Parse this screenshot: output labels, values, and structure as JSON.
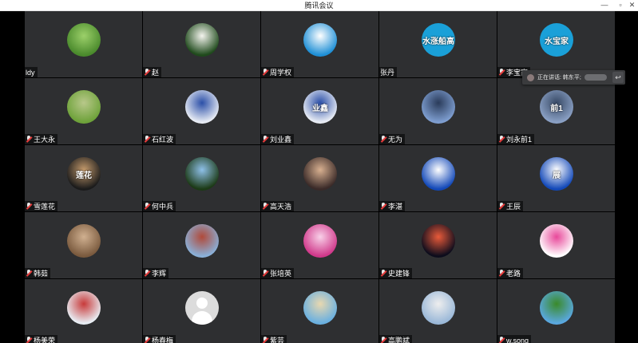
{
  "window": {
    "title": "腾讯会议",
    "min_glyph": "—",
    "max_glyph": "▫",
    "close_glyph": "✕"
  },
  "speaking": {
    "label": "正在讲话: 韩东平;",
    "return_glyph": "↩"
  },
  "participants": [
    {
      "name": "ldy",
      "muted": false,
      "avatar_icon": "green-grass-avatar",
      "avatar_text": "",
      "colors": [
        "#4a8a2c",
        "#9cd06a"
      ]
    },
    {
      "name": "赵",
      "muted": true,
      "avatar_icon": "white-flower-avatar",
      "avatar_text": "",
      "colors": [
        "#1f4a1c",
        "#f4f4ee"
      ]
    },
    {
      "name": "周学权",
      "muted": true,
      "avatar_icon": "doraemon-avatar",
      "avatar_text": "",
      "colors": [
        "#1e8fd6",
        "#ffffff"
      ]
    },
    {
      "name": "张丹",
      "muted": false,
      "avatar_icon": "blue-text-avatar",
      "avatar_text": "水涨船高",
      "colors": [
        "#1aa0d8",
        "#1aa0d8"
      ]
    },
    {
      "name": "李宝家",
      "muted": true,
      "avatar_icon": "blue-text-avatar",
      "avatar_text": "水宝家",
      "colors": [
        "#1aa0d8",
        "#1aa0d8"
      ]
    },
    {
      "name": "王大永",
      "muted": true,
      "avatar_icon": "bird-avatar",
      "avatar_text": "",
      "colors": [
        "#6ea23a",
        "#b8c88a"
      ]
    },
    {
      "name": "石红波",
      "muted": true,
      "avatar_icon": "porcelain-avatar",
      "avatar_text": "",
      "colors": [
        "#e8ecf4",
        "#2b4fa8"
      ]
    },
    {
      "name": "刘业鑫",
      "muted": true,
      "avatar_icon": "porcelain-text-avatar",
      "avatar_text": "业鑫",
      "colors": [
        "#e8ecf4",
        "#2b4fa8"
      ]
    },
    {
      "name": "无为",
      "muted": true,
      "avatar_icon": "statue-sky-avatar",
      "avatar_text": "",
      "colors": [
        "#7e9ed0",
        "#2a3b5a"
      ]
    },
    {
      "name": "刘永前1",
      "muted": true,
      "avatar_icon": "statue-text-avatar",
      "avatar_text": "前1",
      "colors": [
        "#8aa0c4",
        "#384a66"
      ]
    },
    {
      "name": "雪莲花",
      "muted": true,
      "avatar_icon": "person-text-avatar",
      "avatar_text": "莲花",
      "colors": [
        "#1b1b1b",
        "#c49a6c"
      ]
    },
    {
      "name": "何中兵",
      "muted": true,
      "avatar_icon": "tree-sky-avatar",
      "avatar_text": "",
      "colors": [
        "#1c3a16",
        "#8ec0e8"
      ]
    },
    {
      "name": "高天浩",
      "muted": true,
      "avatar_icon": "anime-avatar",
      "avatar_text": "",
      "colors": [
        "#3a2a28",
        "#d8b090"
      ]
    },
    {
      "name": "李湛",
      "muted": true,
      "avatar_icon": "plumeria-avatar",
      "avatar_text": "",
      "colors": [
        "#1248b8",
        "#ffffff"
      ]
    },
    {
      "name": "王辰",
      "muted": true,
      "avatar_icon": "plumeria-text-avatar",
      "avatar_text": "展",
      "colors": [
        "#1248b8",
        "#ffffff"
      ]
    },
    {
      "name": "韩茹",
      "muted": true,
      "avatar_icon": "cat-avatar",
      "avatar_text": "",
      "colors": [
        "#7a5a3e",
        "#d0b090"
      ]
    },
    {
      "name": "李辉",
      "muted": true,
      "avatar_icon": "castle-avatar",
      "avatar_text": "",
      "colors": [
        "#8ab0d8",
        "#b04a3a"
      ]
    },
    {
      "name": "张培英",
      "muted": true,
      "avatar_icon": "orchid-avatar",
      "avatar_text": "",
      "colors": [
        "#d0388a",
        "#f8d0e8"
      ]
    },
    {
      "name": "史建锋",
      "muted": true,
      "avatar_icon": "night-building-avatar",
      "avatar_text": "",
      "colors": [
        "#0c0c1c",
        "#e85a3a"
      ]
    },
    {
      "name": "老路",
      "muted": true,
      "avatar_icon": "colorful-head-avatar",
      "avatar_text": "",
      "colors": [
        "#ffffff",
        "#e8489a"
      ]
    },
    {
      "name": "杨美荣",
      "muted": true,
      "avatar_icon": "skiers-avatar",
      "avatar_text": "",
      "colors": [
        "#e8eef4",
        "#c83a3a"
      ]
    },
    {
      "name": "杨春梅",
      "muted": true,
      "avatar_icon": "default-user-avatar",
      "avatar_text": "",
      "colors": [
        "#d8d8d8",
        "#ffffff"
      ]
    },
    {
      "name": "紫芸",
      "muted": true,
      "avatar_icon": "beach-palm-avatar",
      "avatar_text": "",
      "colors": [
        "#6ab0e0",
        "#e8d8b0"
      ]
    },
    {
      "name": "高鹏斌",
      "muted": true,
      "avatar_icon": "tower-avatar",
      "avatar_text": "",
      "colors": [
        "#9ab8d8",
        "#eeeeee"
      ]
    },
    {
      "name": "w.song",
      "muted": true,
      "avatar_icon": "tree-field-avatar",
      "avatar_text": "",
      "colors": [
        "#5aa8e0",
        "#3a8a2a"
      ]
    }
  ]
}
